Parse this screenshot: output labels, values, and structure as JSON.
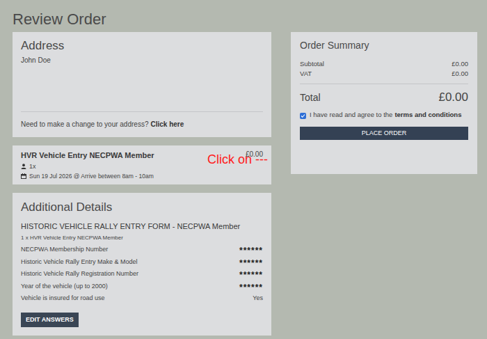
{
  "page": {
    "title": "Review Order"
  },
  "address": {
    "heading": "Address",
    "name": "John Doe",
    "change_prompt": "Need to make a change to your address?",
    "change_link": "Click here"
  },
  "item": {
    "name": "HVR Vehicle Entry NECPWA Member",
    "price": "£0.00",
    "quantity": "1x",
    "date": "Sun 19 Jul 2026 @ Arrive between 8am - 10am"
  },
  "annotation": {
    "text": "Click on ---"
  },
  "details": {
    "heading": "Additional Details",
    "form_title": "HISTORIC VEHICLE RALLY ENTRY FORM - NECPWA Member",
    "form_subtitle": "1 x HVR Vehicle Entry NECPWA Member",
    "fields": [
      {
        "label": "NECPWA Membership Number",
        "value": "******",
        "kind": "masked"
      },
      {
        "label": "Historic Vehicle Rally Entry Make & Model",
        "value": "******",
        "kind": "masked"
      },
      {
        "label": "Historic Vehicle Rally Registration Number",
        "value": "******",
        "kind": "masked"
      },
      {
        "label": "Year of the vehicle (up to 2000)",
        "value": "******",
        "kind": "masked"
      },
      {
        "label": "Vehicle is insured for road use",
        "value": "Yes",
        "kind": "plain"
      }
    ],
    "button": "EDIT ANSWERS"
  },
  "summary": {
    "heading": "Order Summary",
    "rows": [
      {
        "label": "Subtotal",
        "value": "£0.00"
      },
      {
        "label": "VAT",
        "value": "£0.00"
      }
    ],
    "total_label": "Total",
    "total_value": "£0.00",
    "terms": {
      "checked": true,
      "prefix": "I have read and agree to the",
      "link": "terms and conditions"
    },
    "button": "PLACE ORDER"
  }
}
